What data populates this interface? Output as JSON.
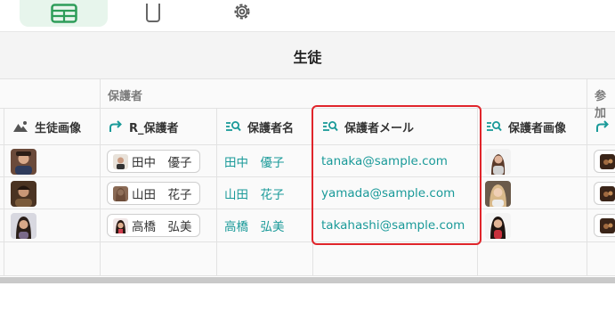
{
  "topbar": {
    "tabs": [
      {
        "icon": "table-icon",
        "active": true
      },
      {
        "icon": "phone-icon",
        "active": false
      },
      {
        "icon": "gear-icon",
        "active": false
      }
    ],
    "accent_color": "#2e9d59"
  },
  "view": {
    "title": "生徒"
  },
  "group_headers": {
    "guardian": "保護者",
    "participation": "参加"
  },
  "columns": [
    {
      "label": "生徒画像",
      "icon": "image-icon"
    },
    {
      "label": "R_保護者",
      "icon": "ref-arrow-icon"
    },
    {
      "label": "保護者名",
      "icon": "lookup-icon"
    },
    {
      "label": "保護者メール",
      "icon": "lookup-icon"
    },
    {
      "label": "保護者画像",
      "icon": "lookup-icon"
    },
    {
      "label": "",
      "icon": "ref-arrow-icon"
    }
  ],
  "rows": [
    {
      "ref": "田中　優子",
      "name": "田中　優子",
      "email": "tanaka@sample.com"
    },
    {
      "ref": "山田　花子",
      "name": "山田　花子",
      "email": "yamada@sample.com"
    },
    {
      "ref": "高橋　弘美",
      "name": "高橋　弘美",
      "email": "takahashi@sample.com"
    }
  ],
  "colors": {
    "link_teal": "#1a9a99",
    "highlight_red": "#e0252b"
  }
}
